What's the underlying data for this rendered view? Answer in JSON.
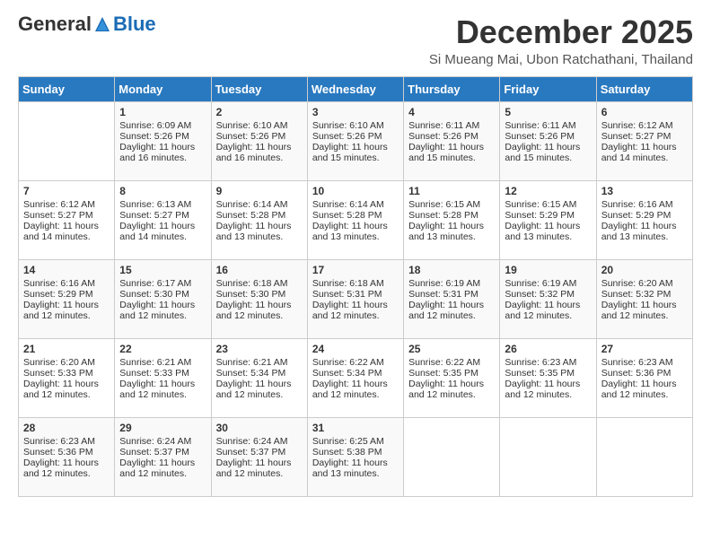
{
  "header": {
    "logo_general": "General",
    "logo_blue": "Blue",
    "month_title": "December 2025",
    "subtitle": "Si Mueang Mai, Ubon Ratchathani, Thailand"
  },
  "days_of_week": [
    "Sunday",
    "Monday",
    "Tuesday",
    "Wednesday",
    "Thursday",
    "Friday",
    "Saturday"
  ],
  "weeks": [
    [
      {
        "day": "",
        "info": ""
      },
      {
        "day": "1",
        "info": "Sunrise: 6:09 AM\nSunset: 5:26 PM\nDaylight: 11 hours and 16 minutes."
      },
      {
        "day": "2",
        "info": "Sunrise: 6:10 AM\nSunset: 5:26 PM\nDaylight: 11 hours and 16 minutes."
      },
      {
        "day": "3",
        "info": "Sunrise: 6:10 AM\nSunset: 5:26 PM\nDaylight: 11 hours and 15 minutes."
      },
      {
        "day": "4",
        "info": "Sunrise: 6:11 AM\nSunset: 5:26 PM\nDaylight: 11 hours and 15 minutes."
      },
      {
        "day": "5",
        "info": "Sunrise: 6:11 AM\nSunset: 5:26 PM\nDaylight: 11 hours and 15 minutes."
      },
      {
        "day": "6",
        "info": "Sunrise: 6:12 AM\nSunset: 5:27 PM\nDaylight: 11 hours and 14 minutes."
      }
    ],
    [
      {
        "day": "7",
        "info": "Sunrise: 6:12 AM\nSunset: 5:27 PM\nDaylight: 11 hours and 14 minutes."
      },
      {
        "day": "8",
        "info": "Sunrise: 6:13 AM\nSunset: 5:27 PM\nDaylight: 11 hours and 14 minutes."
      },
      {
        "day": "9",
        "info": "Sunrise: 6:14 AM\nSunset: 5:28 PM\nDaylight: 11 hours and 13 minutes."
      },
      {
        "day": "10",
        "info": "Sunrise: 6:14 AM\nSunset: 5:28 PM\nDaylight: 11 hours and 13 minutes."
      },
      {
        "day": "11",
        "info": "Sunrise: 6:15 AM\nSunset: 5:28 PM\nDaylight: 11 hours and 13 minutes."
      },
      {
        "day": "12",
        "info": "Sunrise: 6:15 AM\nSunset: 5:29 PM\nDaylight: 11 hours and 13 minutes."
      },
      {
        "day": "13",
        "info": "Sunrise: 6:16 AM\nSunset: 5:29 PM\nDaylight: 11 hours and 13 minutes."
      }
    ],
    [
      {
        "day": "14",
        "info": "Sunrise: 6:16 AM\nSunset: 5:29 PM\nDaylight: 11 hours and 12 minutes."
      },
      {
        "day": "15",
        "info": "Sunrise: 6:17 AM\nSunset: 5:30 PM\nDaylight: 11 hours and 12 minutes."
      },
      {
        "day": "16",
        "info": "Sunrise: 6:18 AM\nSunset: 5:30 PM\nDaylight: 11 hours and 12 minutes."
      },
      {
        "day": "17",
        "info": "Sunrise: 6:18 AM\nSunset: 5:31 PM\nDaylight: 11 hours and 12 minutes."
      },
      {
        "day": "18",
        "info": "Sunrise: 6:19 AM\nSunset: 5:31 PM\nDaylight: 11 hours and 12 minutes."
      },
      {
        "day": "19",
        "info": "Sunrise: 6:19 AM\nSunset: 5:32 PM\nDaylight: 11 hours and 12 minutes."
      },
      {
        "day": "20",
        "info": "Sunrise: 6:20 AM\nSunset: 5:32 PM\nDaylight: 11 hours and 12 minutes."
      }
    ],
    [
      {
        "day": "21",
        "info": "Sunrise: 6:20 AM\nSunset: 5:33 PM\nDaylight: 11 hours and 12 minutes."
      },
      {
        "day": "22",
        "info": "Sunrise: 6:21 AM\nSunset: 5:33 PM\nDaylight: 11 hours and 12 minutes."
      },
      {
        "day": "23",
        "info": "Sunrise: 6:21 AM\nSunset: 5:34 PM\nDaylight: 11 hours and 12 minutes."
      },
      {
        "day": "24",
        "info": "Sunrise: 6:22 AM\nSunset: 5:34 PM\nDaylight: 11 hours and 12 minutes."
      },
      {
        "day": "25",
        "info": "Sunrise: 6:22 AM\nSunset: 5:35 PM\nDaylight: 11 hours and 12 minutes."
      },
      {
        "day": "26",
        "info": "Sunrise: 6:23 AM\nSunset: 5:35 PM\nDaylight: 11 hours and 12 minutes."
      },
      {
        "day": "27",
        "info": "Sunrise: 6:23 AM\nSunset: 5:36 PM\nDaylight: 11 hours and 12 minutes."
      }
    ],
    [
      {
        "day": "28",
        "info": "Sunrise: 6:23 AM\nSunset: 5:36 PM\nDaylight: 11 hours and 12 minutes."
      },
      {
        "day": "29",
        "info": "Sunrise: 6:24 AM\nSunset: 5:37 PM\nDaylight: 11 hours and 12 minutes."
      },
      {
        "day": "30",
        "info": "Sunrise: 6:24 AM\nSunset: 5:37 PM\nDaylight: 11 hours and 12 minutes."
      },
      {
        "day": "31",
        "info": "Sunrise: 6:25 AM\nSunset: 5:38 PM\nDaylight: 11 hours and 13 minutes."
      },
      {
        "day": "",
        "info": ""
      },
      {
        "day": "",
        "info": ""
      },
      {
        "day": "",
        "info": ""
      }
    ]
  ]
}
